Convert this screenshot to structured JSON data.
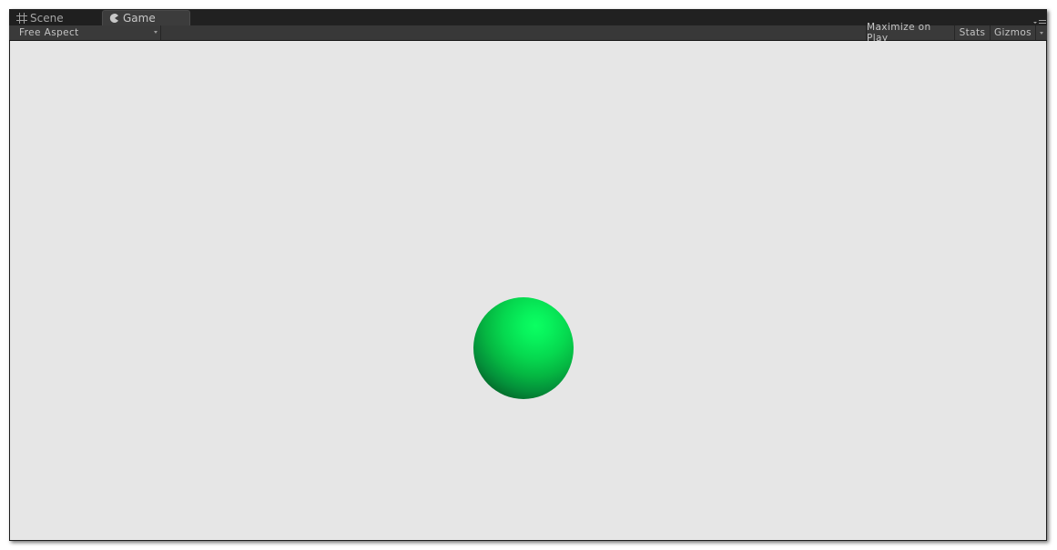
{
  "tabs": [
    {
      "label": "Scene",
      "icon": "scene-grid-icon",
      "active": false
    },
    {
      "label": "Game",
      "icon": "game-pacman-icon",
      "active": true
    }
  ],
  "toolbar": {
    "aspect_label": "Free Aspect",
    "maximize_label": "Maximize on Play",
    "stats_label": "Stats",
    "gizmos_label": "Gizmos"
  },
  "viewport": {
    "background_color": "#e6e6e6",
    "object": {
      "type": "sphere",
      "color": "#0bff62"
    }
  }
}
